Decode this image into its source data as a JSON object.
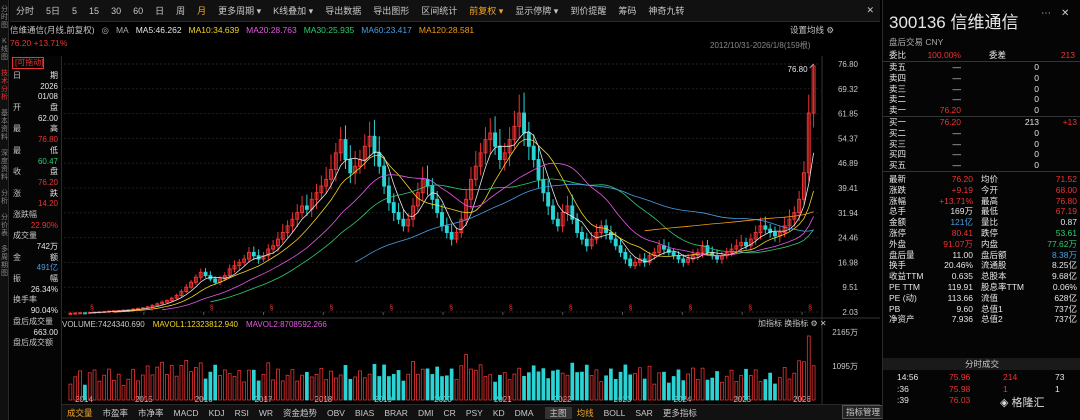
{
  "sidebar": [
    "分时图",
    "K线图",
    "技术分析",
    "基本资料",
    "深度资料",
    "分析",
    "分价表",
    "多周期图"
  ],
  "toolbar": {
    "items": [
      "分时",
      "5日",
      "5",
      "15",
      "30",
      "60",
      "日",
      "周",
      "月",
      "更多周期",
      "K线叠加",
      "导出数据",
      "导出图形",
      "区间统计",
      "前复权",
      "显示停牌",
      "到价提醒",
      "筹码",
      "神奇九转"
    ],
    "active": "月",
    "red": "前复权"
  },
  "info": {
    "name": "信维通信(月线,前复权)",
    "ma": "MA",
    "ma5": "MA5:46.262",
    "ma10": "MA10:34.639",
    "ma20": "MA20:28.763",
    "ma30": "MA30:25.935",
    "ma60": "MA60:23.417",
    "ma120": "MA120:28.581",
    "price_change": "76.20 +13.71%",
    "settings": "设置均线",
    "date_range": "2012/10/31-2026/1/8(159根)"
  },
  "left_panel": {
    "tag": "[可拖动]",
    "rows": [
      {
        "l": "日",
        "r": "期",
        "c": "white"
      },
      {
        "l": "",
        "r": "2026",
        "c": "white"
      },
      {
        "l": "",
        "r": "01/08",
        "c": "white"
      },
      {
        "l": "开",
        "r": "盘",
        "c": "white"
      },
      {
        "l": "",
        "r": "62.00",
        "c": "white"
      },
      {
        "l": "最",
        "r": "高",
        "c": "white"
      },
      {
        "l": "",
        "r": "76.80",
        "c": "red"
      },
      {
        "l": "最",
        "r": "低",
        "c": "white"
      },
      {
        "l": "",
        "r": "60.47",
        "c": "green"
      },
      {
        "l": "收",
        "r": "盘",
        "c": "white"
      },
      {
        "l": "",
        "r": "76.20",
        "c": "red"
      },
      {
        "l": "涨",
        "r": "跌",
        "c": "white"
      },
      {
        "l": "",
        "r": "14.20",
        "c": "red"
      },
      {
        "l": "涨跌幅",
        "r": "",
        "c": "white"
      },
      {
        "l": "",
        "r": "22.90%",
        "c": "red"
      },
      {
        "l": "成交量",
        "r": "",
        "c": "white"
      },
      {
        "l": "",
        "r": "742万",
        "c": "white"
      },
      {
        "l": "金",
        "r": "额",
        "c": "white"
      },
      {
        "l": "",
        "r": "491亿",
        "c": "blue"
      },
      {
        "l": "振",
        "r": "幅",
        "c": "white"
      },
      {
        "l": "",
        "r": "26.34%",
        "c": "white"
      },
      {
        "l": "换手率",
        "r": "",
        "c": "white"
      },
      {
        "l": "",
        "r": "90.04%",
        "c": "white"
      },
      {
        "l": "盘后成交量",
        "r": "",
        "c": "white"
      },
      {
        "l": "",
        "r": "663.00",
        "c": "white"
      },
      {
        "l": "盘后成交额",
        "r": "",
        "c": "white"
      }
    ]
  },
  "volume": {
    "vol": "VOLUME:7424340.690",
    "mavol1": "MAVOL1:12323812.940",
    "mavol2": "MAVOL2:8708592.266",
    "right_label": "加指标 换指标",
    "y_labels": [
      "2165万",
      "1095万"
    ]
  },
  "bottom_tabs": [
    "成交量",
    "市盈率",
    "市净率",
    "MACD",
    "KDJ",
    "RSI",
    "WR",
    "资金趋势",
    "OBV",
    "BIAS",
    "BRAR",
    "DMI",
    "CR",
    "PSY",
    "KD",
    "DMA",
    "主图",
    "均线",
    "BOLL",
    "SAR",
    "更多指标"
  ],
  "bottom_active": [
    "成交量",
    "均线"
  ],
  "indicator_mgr": "指标管理",
  "right": {
    "code": "300136",
    "name": "信维通信",
    "sub": "盘后交易 CNY",
    "book_head": [
      {
        "l": "委比",
        "v": "100.00%",
        "c": "red",
        "l2": "委差",
        "v2": "213",
        "c2": "red"
      }
    ],
    "sells": [
      {
        "l": "卖五",
        "p": "—",
        "q": "0"
      },
      {
        "l": "卖四",
        "p": "—",
        "q": "0"
      },
      {
        "l": "卖三",
        "p": "—",
        "q": "0"
      },
      {
        "l": "卖二",
        "p": "—",
        "q": "0"
      },
      {
        "l": "卖一",
        "p": "76.20",
        "q": "0"
      }
    ],
    "buys": [
      {
        "l": "买一",
        "p": "76.20",
        "q": "213",
        "d": "+13"
      },
      {
        "l": "买二",
        "p": "—",
        "q": "0",
        "d": ""
      },
      {
        "l": "买三",
        "p": "—",
        "q": "0",
        "d": ""
      },
      {
        "l": "买四",
        "p": "—",
        "q": "0",
        "d": ""
      },
      {
        "l": "买五",
        "p": "—",
        "q": "0",
        "d": ""
      }
    ],
    "stats": [
      {
        "a": "最新",
        "b": "76.20",
        "bc": "red",
        "c": "均价",
        "d": "71.52",
        "dc": "red"
      },
      {
        "a": "涨跌",
        "b": "+9.19",
        "bc": "red",
        "c": "今开",
        "d": "68.00",
        "dc": "red"
      },
      {
        "a": "涨幅",
        "b": "+13.71%",
        "bc": "red",
        "c": "最高",
        "d": "76.80",
        "dc": "red"
      },
      {
        "a": "总手",
        "b": "169万",
        "bc": "white",
        "c": "最低",
        "d": "67.19",
        "dc": "red"
      },
      {
        "a": "金额",
        "b": "121亿",
        "bc": "blue",
        "c": "量比",
        "d": "0.87",
        "dc": "white"
      },
      {
        "a": "涨停",
        "b": "80.41",
        "bc": "red",
        "c": "跌停",
        "d": "53.61",
        "dc": "green"
      },
      {
        "a": "外盘",
        "b": "91.07万",
        "bc": "red",
        "c": "内盘",
        "d": "77.62万",
        "dc": "green"
      },
      {
        "a": "盘后量",
        "b": "11.00",
        "bc": "white",
        "c": "盘后额",
        "d": "8.38万",
        "dc": "blue"
      },
      {
        "a": "换手",
        "b": "20.46%",
        "bc": "white",
        "c": "流通股",
        "d": "8.25亿",
        "dc": "white"
      },
      {
        "a": "收益TTM",
        "b": "0.635",
        "bc": "white",
        "c": "总股本",
        "d": "9.68亿",
        "dc": "white"
      },
      {
        "a": "PE TTM",
        "b": "119.91",
        "bc": "white",
        "c": "股息率TTM",
        "d": "0.06%",
        "dc": "white"
      },
      {
        "a": "PE (动)",
        "b": "113.66",
        "bc": "white",
        "c": "流值",
        "d": "628亿",
        "dc": "white"
      },
      {
        "a": "PB",
        "b": "9.60",
        "bc": "white",
        "c": "总值1",
        "d": "737亿",
        "dc": "white"
      },
      {
        "a": "净资产",
        "b": "7.936",
        "bc": "white",
        "c": "总值2",
        "d": "737亿",
        "dc": "white"
      }
    ],
    "trade_head": "分时成交",
    "trades": [
      {
        "t": "14:56",
        "p": "75.96",
        "v": "214",
        "n": "73"
      },
      {
        "t": ":36",
        "p": "75.98",
        "v": "1",
        "n": "1"
      },
      {
        "t": ":39",
        "p": "76.03",
        "v": "",
        "n": ""
      }
    ],
    "logo": "格隆汇"
  },
  "chart_data": {
    "type": "candlestick",
    "title": "信维通信(月线,前复权)",
    "y_ticks": [
      76.8,
      69.32,
      61.85,
      54.37,
      46.89,
      39.41,
      31.94,
      24.46,
      16.98,
      9.51,
      2.03
    ],
    "ylim": [
      2.03,
      76.8
    ],
    "x_ticks": [
      "2014",
      "2015",
      "2016",
      "2017",
      "2018",
      "2019",
      "2020",
      "2021",
      "2022",
      "2023",
      "2024",
      "2025",
      "2026"
    ],
    "annotation": "76.80",
    "closes": [
      1.6,
      1.7,
      1.8,
      1.75,
      1.9,
      2.0,
      2.1,
      2.2,
      2.3,
      2.4,
      2.5,
      2.6,
      2.7,
      2.9,
      3.1,
      3.3,
      3.6,
      4.0,
      4.5,
      5.0,
      5.5,
      6.2,
      7.0,
      8.2,
      9.5,
      11,
      12.5,
      14,
      13,
      12,
      11,
      12,
      13,
      15,
      16,
      17,
      18,
      20,
      19,
      18,
      19,
      21,
      22,
      24,
      26,
      28,
      30,
      32,
      34,
      33,
      36,
      38,
      40,
      42,
      45,
      50,
      54,
      48,
      44,
      46,
      48,
      52,
      55,
      50,
      46,
      40,
      35,
      32,
      30,
      28,
      30,
      34,
      38,
      42,
      40,
      36,
      32,
      28,
      26,
      24,
      26,
      30,
      36,
      42,
      46,
      50,
      54,
      56,
      52,
      48,
      50,
      54,
      58,
      62,
      56,
      52,
      48,
      42,
      38,
      34,
      30,
      28,
      32,
      34,
      30,
      26,
      24,
      22,
      24,
      26,
      28,
      26,
      24,
      22,
      20,
      18,
      16,
      17,
      18,
      17,
      19,
      20,
      22,
      21,
      20,
      19,
      18,
      17,
      18,
      19,
      20,
      22,
      20,
      19,
      18,
      19,
      20,
      21,
      22,
      23,
      22,
      24,
      26,
      28,
      27,
      26,
      25,
      26,
      28,
      30,
      32,
      36,
      44,
      62,
      76.2
    ],
    "vol_max_label": "2165万",
    "vol_mid_label": "1095万"
  }
}
